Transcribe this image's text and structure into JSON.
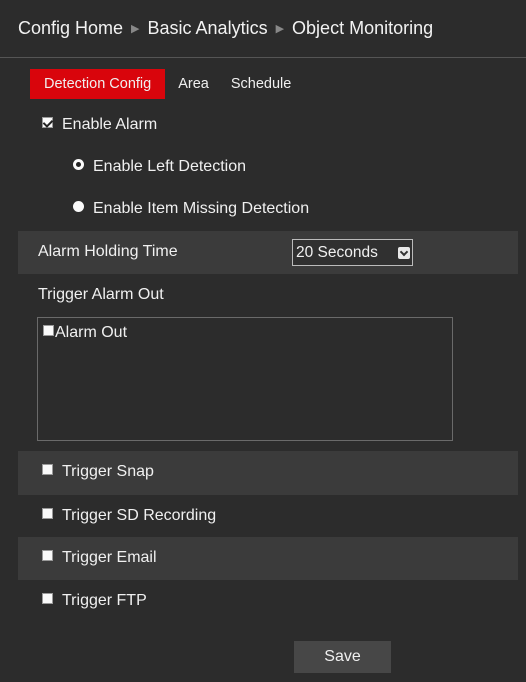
{
  "breadcrumb": {
    "items": [
      "Config Home",
      "Basic Analytics",
      "Object Monitoring"
    ]
  },
  "tabs": {
    "items": [
      {
        "label": "Detection Config",
        "active": true
      },
      {
        "label": "Area",
        "active": false
      },
      {
        "label": "Schedule",
        "active": false
      }
    ]
  },
  "enable_alarm": {
    "label": "Enable Alarm",
    "checked": true
  },
  "detection_mode": {
    "options": [
      {
        "label": "Enable Left Detection",
        "selected": true
      },
      {
        "label": "Enable Item Missing Detection",
        "selected": false
      }
    ]
  },
  "alarm_holding_time": {
    "label": "Alarm Holding Time",
    "value": "20 Seconds"
  },
  "trigger_alarm_out": {
    "label": "Trigger Alarm Out",
    "items": [
      {
        "label": "Alarm Out",
        "checked": false
      }
    ]
  },
  "triggers": [
    {
      "label": "Trigger Snap",
      "checked": false
    },
    {
      "label": "Trigger SD Recording",
      "checked": false
    },
    {
      "label": "Trigger Email",
      "checked": false
    },
    {
      "label": "Trigger FTP",
      "checked": false
    }
  ],
  "save_label": "Save",
  "colors": {
    "background": "#2c2c2c",
    "row_shade": "#3b3b3b",
    "active_tab": "#d9050c",
    "button": "#474747"
  }
}
